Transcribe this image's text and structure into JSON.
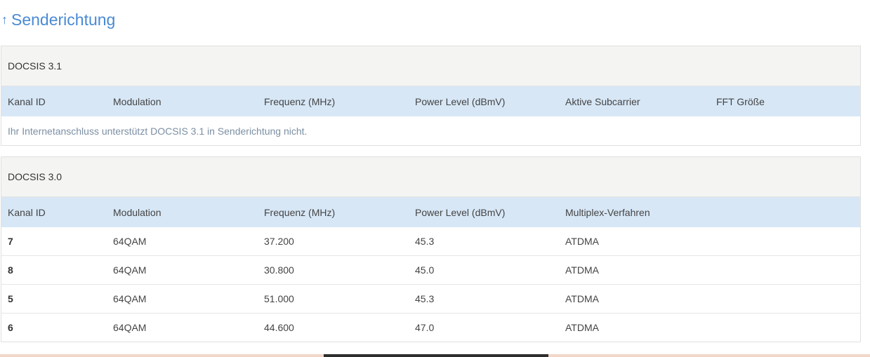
{
  "section": {
    "arrow": "↑",
    "title": "Senderichtung"
  },
  "docsis31": {
    "title": "DOCSIS 3.1",
    "columns": [
      "Kanal ID",
      "Modulation",
      "Frequenz (MHz)",
      "Power Level (dBmV)",
      "Aktive Subcarrier",
      "FFT Größe"
    ],
    "notice": "Ihr Internetanschluss unterstützt DOCSIS 3.1 in Senderichtung nicht."
  },
  "docsis30": {
    "title": "DOCSIS 3.0",
    "columns": [
      "Kanal ID",
      "Modulation",
      "Frequenz (MHz)",
      "Power Level (dBmV)",
      "Multiplex-Verfahren"
    ],
    "rows": [
      [
        "7",
        "64QAM",
        "37.200",
        "45.3",
        "ATDMA"
      ],
      [
        "8",
        "64QAM",
        "30.800",
        "45.0",
        "ATDMA"
      ],
      [
        "5",
        "64QAM",
        "51.000",
        "45.3",
        "ATDMA"
      ],
      [
        "6",
        "64QAM",
        "44.600",
        "47.0",
        "ATDMA"
      ]
    ]
  },
  "colors": {
    "accent": "#4a8ad4",
    "table_header_bg": "#d7e7f6",
    "box_header_bg": "#f4f4f2"
  },
  "icons": {
    "section_arrow": "arrow-up-icon"
  }
}
